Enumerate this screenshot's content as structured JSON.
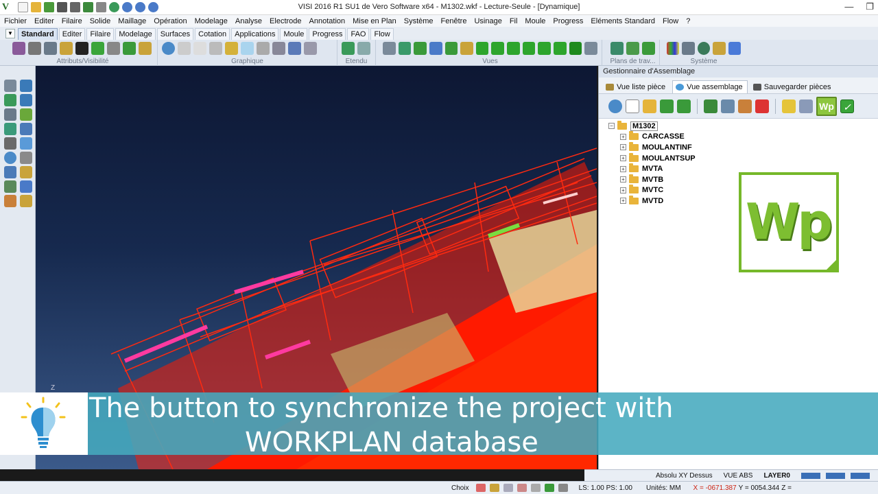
{
  "window": {
    "app_logo": "V",
    "title": "VISI 2016 R1 SU1 de Vero Software x64 - M1302.wkf - Lecture-Seule - [Dynamique]",
    "minimize": "—",
    "restore": "❐"
  },
  "menu": [
    "Fichier",
    "Editer",
    "Filaire",
    "Solide",
    "Maillage",
    "Opération",
    "Modelage",
    "Analyse",
    "Electrode",
    "Annotation",
    "Mise en Plan",
    "Système",
    "Fenêtre",
    "Usinage",
    "Fil",
    "Moule",
    "Progress",
    "Eléments Standard",
    "Flow",
    "?"
  ],
  "ribbon_tabs": {
    "dropdown": "▼",
    "items": [
      "Standard",
      "Editer",
      "Filaire",
      "Modelage",
      "Surfaces",
      "Cotation",
      "Applications",
      "Moule",
      "Progress",
      "FAO",
      "Flow"
    ],
    "active": "Standard"
  },
  "ribbon_groups": {
    "attributs": "Attributs/Visibilité",
    "graphique": "Graphique",
    "etendu": "Etendu",
    "vues": "Vues",
    "plans": "Plans de trav...",
    "systeme": "Système"
  },
  "viewport": {
    "axis_label": "Z"
  },
  "assembly_panel": {
    "title": "Gestionnaire d'Assemblage",
    "tabs": [
      "Vue liste pièce",
      "Vue assemblage",
      "Sauvegarder pièces"
    ],
    "active_tab": "Vue assemblage",
    "wp_button": "Wp",
    "check_button": "✓",
    "tree": {
      "root": "M1302",
      "children": [
        "CARCASSE",
        "MOULANTINF",
        "MOULANTSUP",
        "MVTA",
        "MVTB",
        "MVTC",
        "MVTD"
      ]
    },
    "logo_text": "Wp",
    "expand_symbol": "+",
    "collapse_symbol": "−"
  },
  "status": {
    "mode": "Absolu XY Dessus",
    "view": "VUE ABS",
    "layer": "LAYER0"
  },
  "bottom": {
    "choix": "Choix",
    "scale": "LS: 1.00 PS: 1.00",
    "units": "Unités: MM",
    "coord_x": "X = -0671.387",
    "coord_y": "Y = 0054.344",
    "coord_z": "Z ="
  },
  "caption": {
    "line1": "The button to synchronize the project with",
    "line2": "WORKPLAN database"
  },
  "colors": {
    "accent_green": "#7dbe31",
    "caption_band": "#46aabe",
    "model_red": "#ff1a00"
  }
}
